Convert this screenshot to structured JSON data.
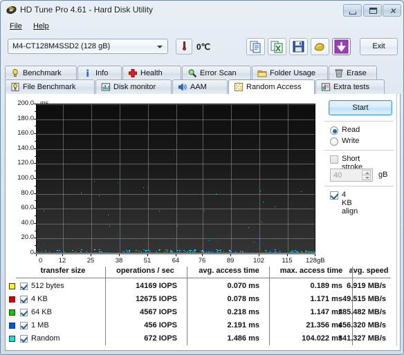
{
  "window": {
    "title": "HD Tune Pro 4.61 - Hard Disk Utility",
    "icon": "disk-icon",
    "minimize": "minimize-icon",
    "maximize": "maximize-icon",
    "close": "✕"
  },
  "menu": {
    "items": [
      {
        "label": "File"
      },
      {
        "label": "Help"
      }
    ]
  },
  "toolbar": {
    "drive": "M4-CT128M4SSD2 (128 gB)",
    "temperature": "0℃",
    "thermometer_icon": "thermometer-icon",
    "buttons": [
      {
        "name": "copy-icon"
      },
      {
        "name": "copy-excel-icon"
      },
      {
        "name": "save-icon"
      },
      {
        "name": "folder-gold-icon"
      },
      {
        "name": "download-arrow-icon"
      }
    ],
    "exit_label": "Exit"
  },
  "tabs": {
    "row1": [
      {
        "label": "Benchmark",
        "icon": "lightbulb-icon",
        "active": false
      },
      {
        "label": "Info",
        "icon": "info-icon",
        "active": false
      },
      {
        "label": "Health",
        "icon": "health-cross-icon",
        "active": false
      },
      {
        "label": "Error Scan",
        "icon": "magnifier-icon",
        "active": false
      },
      {
        "label": "Folder Usage",
        "icon": "folder-icon",
        "active": false
      },
      {
        "label": "Erase",
        "icon": "trash-icon",
        "active": false
      }
    ],
    "row2": [
      {
        "label": "File Benchmark",
        "icon": "file-benchmark-icon",
        "active": false
      },
      {
        "label": "Disk monitor",
        "icon": "bar-chart-icon",
        "active": false
      },
      {
        "label": "AAM",
        "icon": "speaker-icon",
        "active": false
      },
      {
        "label": "Random Access",
        "icon": "random-access-icon",
        "active": true
      },
      {
        "label": "Extra tests",
        "icon": "extra-tests-icon",
        "active": false
      }
    ]
  },
  "controls": {
    "start_label": "Start",
    "mode": {
      "read_label": "Read",
      "write_label": "Write",
      "selected": "Read"
    },
    "short_stroke": {
      "label": "Short stroke",
      "checked": false
    },
    "stroke_value": "40",
    "stroke_unit": "gB",
    "align": {
      "label": "4 KB align",
      "checked": true
    }
  },
  "chart_data": {
    "type": "scatter",
    "title": "",
    "xlabel": "",
    "ylabel": "ms",
    "yunit": "ms",
    "xunit": "gB",
    "xlim": [
      0,
      128
    ],
    "ylim": [
      0,
      200
    ],
    "ytick_labels": [
      "200.0",
      "180.0",
      "160.0",
      "140.0",
      "120.0",
      "100.0",
      "80.0",
      "60.0",
      "40.0",
      "20.0",
      "0"
    ],
    "ytick_values": [
      200,
      180,
      160,
      140,
      120,
      100,
      80,
      60,
      40,
      20,
      0
    ],
    "xtick_labels": [
      "0",
      "12",
      "25",
      "38",
      "51",
      "64",
      "76",
      "89",
      "102",
      "115",
      "128gB"
    ],
    "xtick_values": [
      0,
      12,
      25,
      38,
      51,
      64,
      76,
      89,
      102,
      115,
      128
    ],
    "grid": true,
    "legend": "table",
    "background": "#1b1b1b",
    "series": [
      {
        "name": "512 bytes",
        "color": "#ffff00",
        "avg_ms": 0.07,
        "max_ms": 0.189
      },
      {
        "name": "4 KB",
        "color": "#cc0000",
        "avg_ms": 0.078,
        "max_ms": 1.171
      },
      {
        "name": "64 KB",
        "color": "#00cc00",
        "avg_ms": 0.218,
        "max_ms": 1.147
      },
      {
        "name": "1 MB",
        "color": "#0055dd",
        "avg_ms": 2.191,
        "max_ms": 21.356
      },
      {
        "name": "Random",
        "color": "#00e5e5",
        "avg_ms": 1.486,
        "max_ms": 104.022
      }
    ]
  },
  "results": {
    "headers": [
      "transfer size",
      "operations / sec",
      "avg. access time",
      "max. access time",
      "avg. speed"
    ],
    "rows": [
      {
        "color": "#ffff00",
        "checked": true,
        "size": "512 bytes",
        "iops": "14169 IOPS",
        "avg_access": "0.070 ms",
        "max_access": "0.189 ms",
        "avg_speed": "6.919 MB/s"
      },
      {
        "color": "#cc0000",
        "checked": true,
        "size": "4 KB",
        "iops": "12675 IOPS",
        "avg_access": "0.078 ms",
        "max_access": "1.171 ms",
        "avg_speed": "49.515 MB/s"
      },
      {
        "color": "#00cc00",
        "checked": true,
        "size": "64 KB",
        "iops": "4567 IOPS",
        "avg_access": "0.218 ms",
        "max_access": "1.147 ms",
        "avg_speed": "285.482 MB/s"
      },
      {
        "color": "#0055dd",
        "checked": true,
        "size": "1 MB",
        "iops": "456 IOPS",
        "avg_access": "2.191 ms",
        "max_access": "21.356 ms",
        "avg_speed": "456.320 MB/s"
      },
      {
        "color": "#00e5e5",
        "checked": true,
        "size": "Random",
        "iops": "672 IOPS",
        "avg_access": "1.486 ms",
        "max_access": "104.022 ms",
        "avg_speed": "341.327 MB/s"
      }
    ]
  }
}
